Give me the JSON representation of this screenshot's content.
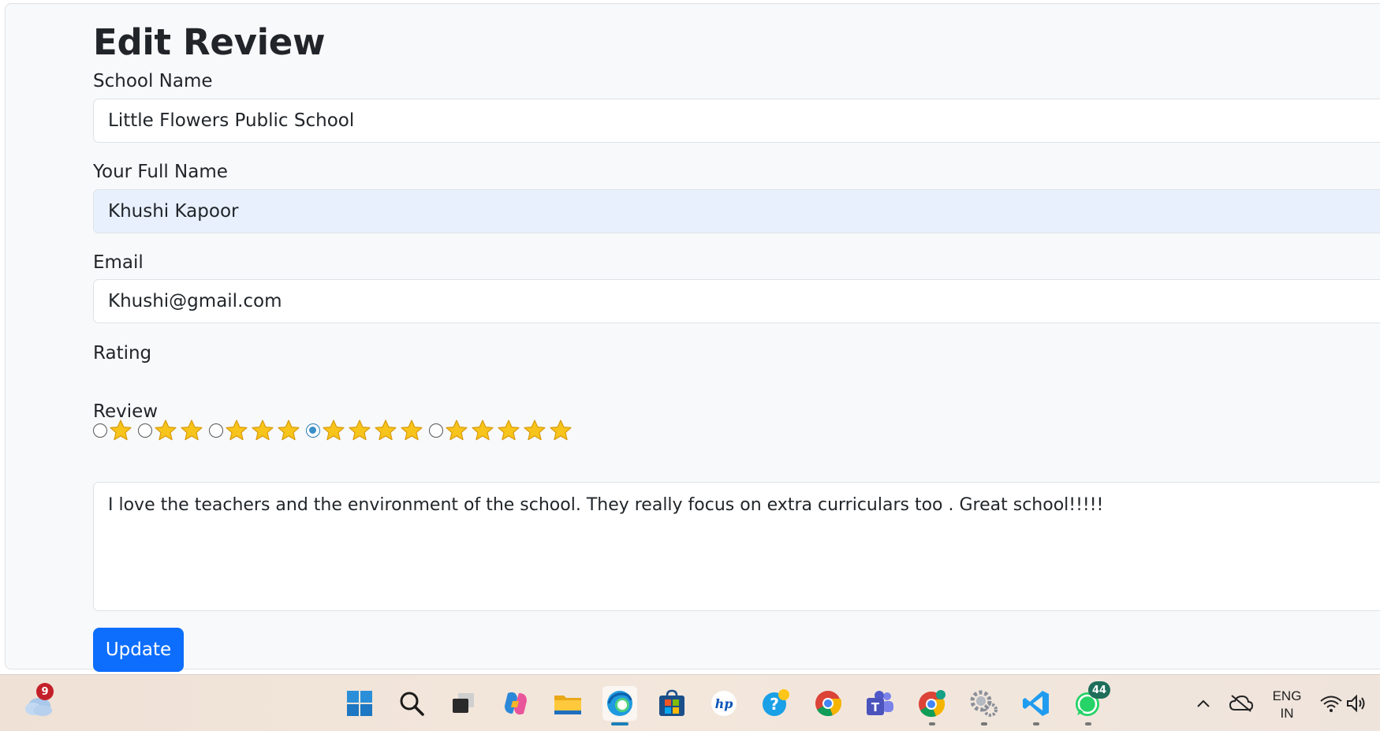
{
  "page": {
    "title": "Edit Review"
  },
  "form": {
    "school_name": {
      "label": "School Name",
      "value": "Little Flowers Public School"
    },
    "full_name": {
      "label": "Your Full Name",
      "value": "Khushi Kapoor"
    },
    "email": {
      "label": "Email",
      "value": "Khushi@gmail.com"
    },
    "rating": {
      "label": "Rating",
      "options": [
        1,
        2,
        3,
        4,
        5
      ],
      "selected": 4
    },
    "review": {
      "label": "Review",
      "value": "I love the teachers and the environment of the school. They really focus on extra curriculars too . Great school!!!!!"
    },
    "submit_label": "Update"
  },
  "taskbar": {
    "weather_badge": "9",
    "whatsapp_badge": "44",
    "language_line1": "ENG",
    "language_line2": "IN",
    "apps": [
      "windows-start-icon",
      "search-icon",
      "task-view-icon",
      "copilot-icon",
      "file-explorer-icon",
      "edge-icon",
      "microsoft-store-icon",
      "hp-icon",
      "get-help-icon",
      "chrome-icon",
      "teams-icon",
      "chrome-profile-icon",
      "settings-icon",
      "vscode-icon",
      "whatsapp-icon"
    ]
  }
}
